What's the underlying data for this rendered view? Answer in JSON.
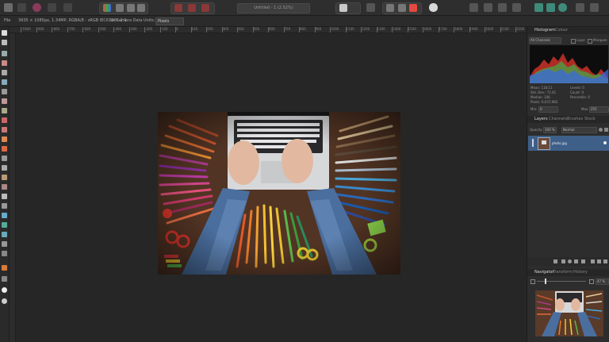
{
  "toolbar": {
    "document_title": "Untitled - 1 (2.52%)"
  },
  "context_bar": {
    "menu_label": "File",
    "doc_info": "3935 × 1085px, 1.34MP, RGBA/8 - sRGB IEC61966-2.1",
    "camera_data": "No Camera Data",
    "units_label": "Units:",
    "units_value": "Pixels"
  },
  "ruler": {
    "ticks": [
      "-1000",
      "-900",
      "-800",
      "-700",
      "-600",
      "-500",
      "-400",
      "-300",
      "-200",
      "-100",
      "0",
      "100",
      "200",
      "300",
      "400",
      "500",
      "600",
      "700",
      "800",
      "900",
      "1000",
      "1100",
      "1200",
      "1300",
      "1400",
      "1500",
      "1600",
      "1700",
      "1800",
      "1900",
      "2000",
      "2100",
      "2200",
      "2300"
    ]
  },
  "histogram_panel": {
    "tabs": [
      "Histogram",
      "Colour"
    ],
    "channel": "All Channels",
    "layer_label": "Layer",
    "marquee_label": "Marquee",
    "stats": {
      "mean": "Mean: 118.11",
      "std_dev": "Std. Dev.: 72.41",
      "median": "Median: 106",
      "pixels": "Pixels: 6,037,983",
      "levels": "Levels: 0",
      "count": "Count: 0",
      "percentile": "Percentile: 0"
    },
    "min_label": "Min:",
    "min_value": "0",
    "max_label": "Max:",
    "max_value": "255"
  },
  "layers_panel": {
    "tabs": [
      "Layers",
      "Channels",
      "Brushes",
      "Stock"
    ],
    "opacity_label": "Opacity:",
    "opacity_value": "100 %",
    "blend_mode": "Normal",
    "layer_name": "photo.jpg"
  },
  "navigator_panel": {
    "tabs": [
      "Navigator",
      "Transform",
      "History"
    ],
    "zoom": "47 %"
  },
  "colors": {
    "accent": "#e34a3f",
    "selected_layer": "#3e5f87",
    "panel_bg": "#2d2d2d"
  }
}
